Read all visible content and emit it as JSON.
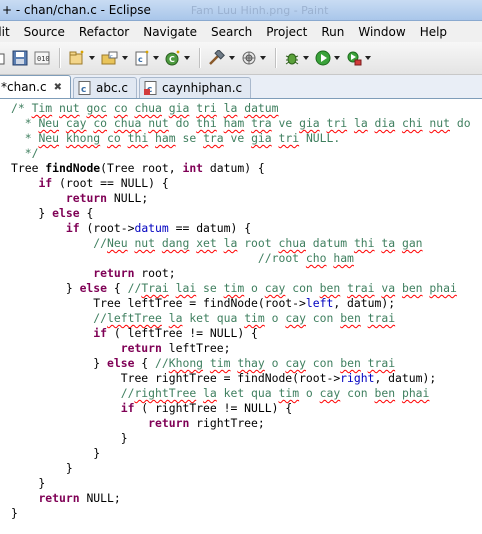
{
  "window": {
    "title": "+ - chan/chan.c - Eclipse",
    "ghost_title": "Fam Luu Hinh.png - Paint"
  },
  "menu": [
    "dit",
    "Source",
    "Refactor",
    "Navigate",
    "Search",
    "Project",
    "Run",
    "Window",
    "Help"
  ],
  "toolbar": {
    "icons": [
      "new-project-icon",
      "new-folder-icon",
      "new-source-icon",
      "new-class-icon",
      "build-hammer-icon",
      "build-target-icon",
      "debug-icon",
      "run-icon",
      "external-tools-icon"
    ]
  },
  "tabs": [
    {
      "label": "*chan.c",
      "active": true,
      "closable": true
    },
    {
      "label": "abc.c",
      "active": false
    },
    {
      "label": "caynhiphan.c",
      "active": false
    }
  ],
  "code_lines": [
    [
      [
        "cm",
        "/* "
      ],
      [
        "cm sp",
        "Tim"
      ],
      [
        "cm",
        " "
      ],
      [
        "cm sp",
        "nut"
      ],
      [
        "cm",
        " "
      ],
      [
        "cm sp",
        "goc"
      ],
      [
        "cm",
        " "
      ],
      [
        "cm sp",
        "co"
      ],
      [
        "cm",
        " "
      ],
      [
        "cm sp",
        "chua"
      ],
      [
        "cm",
        " "
      ],
      [
        "cm sp",
        "gia"
      ],
      [
        "cm",
        " "
      ],
      [
        "cm sp",
        "tri"
      ],
      [
        "cm",
        " "
      ],
      [
        "cm sp",
        "la"
      ],
      [
        "cm",
        " "
      ],
      [
        "cm sp",
        "datum"
      ]
    ],
    [
      [
        "cm",
        "  * "
      ],
      [
        "cm sp",
        "Neu"
      ],
      [
        "cm",
        " "
      ],
      [
        "cm sp",
        "cay"
      ],
      [
        "cm",
        " "
      ],
      [
        "cm sp",
        "co"
      ],
      [
        "cm",
        " "
      ],
      [
        "cm sp",
        "chua"
      ],
      [
        "cm",
        " "
      ],
      [
        "cm sp",
        "nut"
      ],
      [
        "cm",
        " do "
      ],
      [
        "cm sp",
        "thi"
      ],
      [
        "cm",
        " "
      ],
      [
        "cm sp",
        "ham"
      ],
      [
        "cm",
        " "
      ],
      [
        "cm sp",
        "tra"
      ],
      [
        "cm",
        " ve "
      ],
      [
        "cm sp",
        "gia"
      ],
      [
        "cm",
        " "
      ],
      [
        "cm sp",
        "tri"
      ],
      [
        "cm",
        " "
      ],
      [
        "cm sp",
        "la"
      ],
      [
        "cm",
        " "
      ],
      [
        "cm sp",
        "dia"
      ],
      [
        "cm",
        " "
      ],
      [
        "cm sp",
        "chi"
      ],
      [
        "cm",
        " "
      ],
      [
        "cm sp",
        "nut"
      ],
      [
        "cm",
        " do"
      ]
    ],
    [
      [
        "cm",
        "  * "
      ],
      [
        "cm sp",
        "Neu"
      ],
      [
        "cm",
        " "
      ],
      [
        "cm sp",
        "khong"
      ],
      [
        "cm",
        " "
      ],
      [
        "cm sp",
        "co"
      ],
      [
        "cm",
        " "
      ],
      [
        "cm sp",
        "thi"
      ],
      [
        "cm",
        " "
      ],
      [
        "cm sp",
        "ham"
      ],
      [
        "cm",
        " se "
      ],
      [
        "cm sp",
        "tra"
      ],
      [
        "cm",
        " ve "
      ],
      [
        "cm sp",
        "gia"
      ],
      [
        "cm",
        " "
      ],
      [
        "cm sp",
        "tri"
      ],
      [
        "cm",
        " NULL."
      ]
    ],
    [
      [
        "cm",
        "  */"
      ]
    ],
    [
      [
        "",
        "Tree "
      ],
      [
        "fn",
        "findNode"
      ],
      [
        "",
        "(Tree root, "
      ],
      [
        "kw",
        "int"
      ],
      [
        "",
        " datum) {"
      ]
    ],
    [
      [
        "",
        "    "
      ],
      [
        "kw",
        "if"
      ],
      [
        "",
        " (root == NULL) {"
      ]
    ],
    [
      [
        "",
        "        "
      ],
      [
        "kw",
        "return"
      ],
      [
        "",
        " NULL;"
      ]
    ],
    [
      [
        "",
        "    } "
      ],
      [
        "kw",
        "else"
      ],
      [
        "",
        " {"
      ]
    ],
    [
      [
        "",
        "        "
      ],
      [
        "kw",
        "if"
      ],
      [
        "",
        " (root->"
      ],
      [
        "fd",
        "datum"
      ],
      [
        "",
        " == datum) {"
      ]
    ],
    [
      [
        "",
        "            "
      ],
      [
        "cm",
        "//"
      ],
      [
        "cm sp",
        "Neu"
      ],
      [
        "cm",
        " "
      ],
      [
        "cm sp",
        "nut"
      ],
      [
        "cm",
        " "
      ],
      [
        "cm sp",
        "dang"
      ],
      [
        "cm",
        " "
      ],
      [
        "cm sp",
        "xet"
      ],
      [
        "cm",
        " "
      ],
      [
        "cm sp",
        "la"
      ],
      [
        "cm",
        " root "
      ],
      [
        "cm sp",
        "chua"
      ],
      [
        "cm",
        " datum "
      ],
      [
        "cm sp",
        "thi"
      ],
      [
        "cm",
        " "
      ],
      [
        "cm sp",
        "ta"
      ],
      [
        "cm",
        " "
      ],
      [
        "cm sp",
        "gan"
      ]
    ],
    [
      [
        "",
        "                                    "
      ],
      [
        "cm",
        "//root "
      ],
      [
        "cm sp",
        "cho"
      ],
      [
        "cm",
        " "
      ],
      [
        "cm sp",
        "ham"
      ]
    ],
    [
      [
        "",
        "            "
      ],
      [
        "kw",
        "return"
      ],
      [
        "",
        " root;"
      ]
    ],
    [
      [
        "",
        "        } "
      ],
      [
        "kw",
        "else"
      ],
      [
        "",
        " { "
      ],
      [
        "cm",
        "//"
      ],
      [
        "cm sp",
        "Trai"
      ],
      [
        "cm",
        " "
      ],
      [
        "cm sp",
        "lai"
      ],
      [
        "cm",
        " se "
      ],
      [
        "cm sp",
        "tim"
      ],
      [
        "cm",
        " o "
      ],
      [
        "cm sp",
        "cay"
      ],
      [
        "cm",
        " con "
      ],
      [
        "cm sp",
        "ben"
      ],
      [
        "cm",
        " "
      ],
      [
        "cm sp",
        "trai"
      ],
      [
        "cm",
        " "
      ],
      [
        "cm sp",
        "va"
      ],
      [
        "cm",
        " "
      ],
      [
        "cm sp",
        "ben"
      ],
      [
        "cm",
        " "
      ],
      [
        "cm sp",
        "phai"
      ]
    ],
    [
      [
        "",
        "            Tree leftTree = findNode(root->"
      ],
      [
        "fd",
        "left"
      ],
      [
        "",
        ", datum);"
      ]
    ],
    [
      [
        "",
        "            "
      ],
      [
        "cm",
        "//"
      ],
      [
        "cm sp",
        "leftTree"
      ],
      [
        "cm",
        " "
      ],
      [
        "cm sp",
        "la"
      ],
      [
        "cm",
        " ket qua "
      ],
      [
        "cm sp",
        "tim"
      ],
      [
        "cm",
        " o "
      ],
      [
        "cm sp",
        "cay"
      ],
      [
        "cm",
        " con "
      ],
      [
        "cm sp",
        "ben"
      ],
      [
        "cm",
        " "
      ],
      [
        "cm sp",
        "trai"
      ]
    ],
    [
      [
        "",
        "            "
      ],
      [
        "kw",
        "if"
      ],
      [
        "",
        " ( leftTree != NULL) {"
      ]
    ],
    [
      [
        "",
        "                "
      ],
      [
        "kw",
        "return"
      ],
      [
        "",
        " leftTree;"
      ]
    ],
    [
      [
        "",
        "            } "
      ],
      [
        "kw",
        "else"
      ],
      [
        "",
        " { "
      ],
      [
        "cm",
        "//"
      ],
      [
        "cm sp",
        "Khong"
      ],
      [
        "cm",
        " "
      ],
      [
        "cm sp",
        "tim"
      ],
      [
        "cm",
        " "
      ],
      [
        "cm sp",
        "thay"
      ],
      [
        "cm",
        " o "
      ],
      [
        "cm sp",
        "cay"
      ],
      [
        "cm",
        " con "
      ],
      [
        "cm sp",
        "ben"
      ],
      [
        "cm",
        " "
      ],
      [
        "cm sp",
        "trai"
      ]
    ],
    [
      [
        "",
        "                Tree rightTree = findNode(root->"
      ],
      [
        "fd",
        "right"
      ],
      [
        "",
        ", datum);"
      ]
    ],
    [
      [
        "",
        "                "
      ],
      [
        "cm",
        "//"
      ],
      [
        "cm sp",
        "rightTree"
      ],
      [
        "cm",
        " "
      ],
      [
        "cm sp",
        "la"
      ],
      [
        "cm",
        " ket qua "
      ],
      [
        "cm sp",
        "tim"
      ],
      [
        "cm",
        " o "
      ],
      [
        "cm sp",
        "cay"
      ],
      [
        "cm",
        " con "
      ],
      [
        "cm sp",
        "ben"
      ],
      [
        "cm",
        " "
      ],
      [
        "cm sp",
        "phai"
      ]
    ],
    [
      [
        "",
        "                "
      ],
      [
        "kw",
        "if"
      ],
      [
        "",
        " ( rightTree != NULL) {"
      ]
    ],
    [
      [
        "",
        "                    "
      ],
      [
        "kw",
        "return"
      ],
      [
        "",
        " rightTree;"
      ]
    ],
    [
      [
        "",
        "                }"
      ]
    ],
    [
      [
        "",
        "            }"
      ]
    ],
    [
      [
        "",
        "        }"
      ]
    ],
    [
      [
        "",
        "    }"
      ]
    ],
    [
      [
        "",
        "    "
      ],
      [
        "kw",
        "return"
      ],
      [
        "",
        " NULL;"
      ]
    ],
    [
      [
        "",
        "}"
      ]
    ]
  ]
}
